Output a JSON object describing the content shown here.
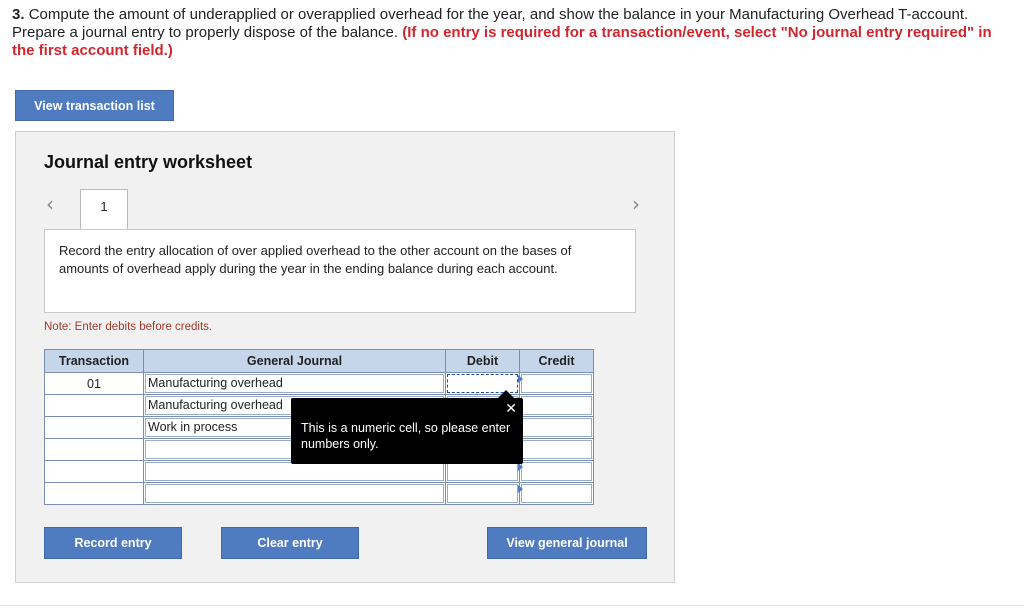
{
  "question": {
    "number": "3.",
    "text": "Compute the amount of underapplied or overapplied overhead for the year, and show the balance in your Manufacturing Overhead T-account. Prepare a journal entry to properly dispose of the balance.",
    "instruction": "(If no entry is required for a transaction/event, select \"No journal entry required\" in the first account field.)"
  },
  "buttons": {
    "view_transaction_list": "View transaction list",
    "record_entry": "Record entry",
    "clear_entry": "Clear entry",
    "view_general_journal": "View general journal"
  },
  "worksheet": {
    "title": "Journal entry worksheet",
    "tab_label": "1",
    "prev_icon": "chevron-left-icon",
    "next_icon": "chevron-right-icon",
    "description": "Record the entry allocation of over applied overhead to the other account on the bases of amounts of overhead apply during the year in the ending balance during each account.",
    "note": "Note: Enter debits before credits."
  },
  "table": {
    "headers": [
      "Transaction",
      "General Journal",
      "Debit",
      "Credit"
    ],
    "rows": [
      {
        "transaction": "01",
        "account": "Manufacturing overhead",
        "debit": "",
        "credit": ""
      },
      {
        "transaction": "",
        "account": "Manufacturing overhead",
        "debit": "",
        "credit": ""
      },
      {
        "transaction": "",
        "account": "Work in process",
        "debit": "",
        "credit": ""
      },
      {
        "transaction": "",
        "account": "",
        "debit": "",
        "credit": ""
      },
      {
        "transaction": "",
        "account": "",
        "debit": "",
        "credit": ""
      },
      {
        "transaction": "",
        "account": "",
        "debit": "",
        "credit": ""
      }
    ]
  },
  "tooltip": {
    "text": "This is a numeric cell, so please enter numbers only.",
    "close_symbol": "✕"
  },
  "colors": {
    "button_blue": "#4f7cc0",
    "header_blue": "#c5d5ea",
    "instruction_red": "#d0262e",
    "note_red": "#a33a2a"
  }
}
